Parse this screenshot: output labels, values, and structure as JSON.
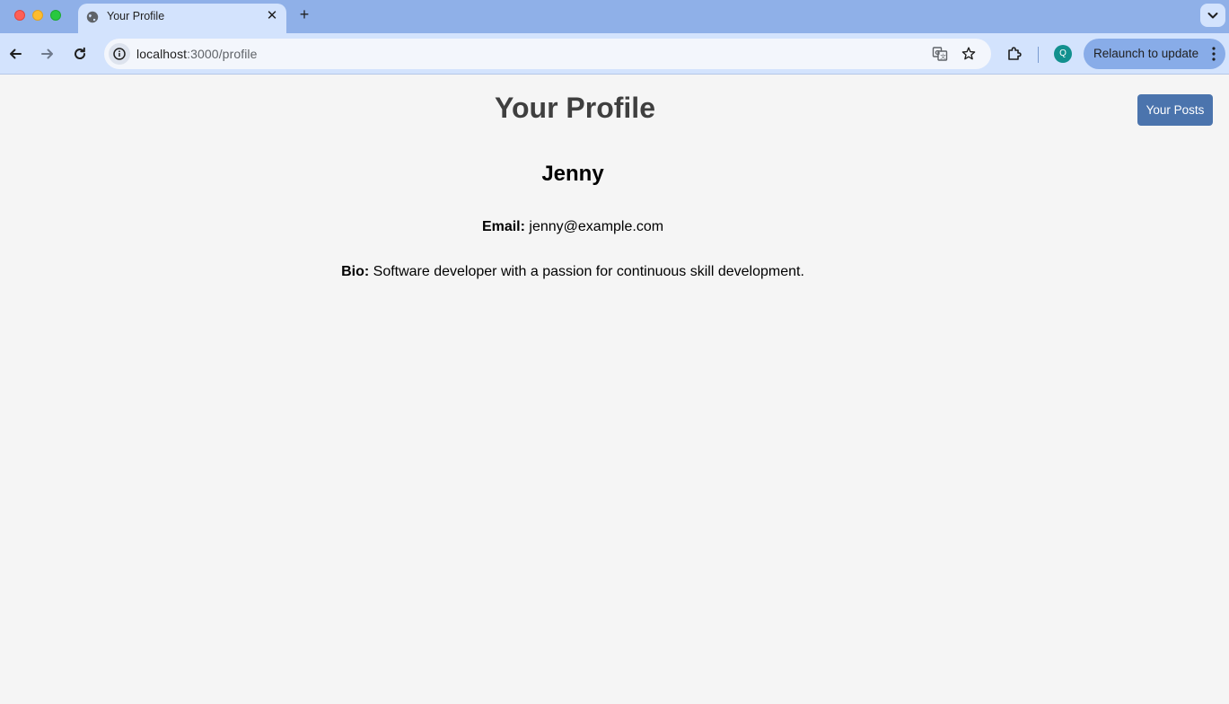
{
  "browser": {
    "tab": {
      "title": "Your Profile"
    },
    "url": {
      "host": "localhost",
      "path": ":3000/profile"
    },
    "relaunch_label": "Relaunch to update",
    "avatar_initial": "Q",
    "tab_close_glyph": "✕",
    "new_tab_glyph": "+",
    "icons": [
      "globe-icon",
      "close-icon",
      "plus-icon",
      "chevron-down-icon",
      "back-arrow-icon",
      "forward-arrow-icon",
      "reload-icon",
      "site-info-icon",
      "translate-icon",
      "star-icon",
      "extensions-icon",
      "more-vert-icon"
    ]
  },
  "page": {
    "title": "Your Profile",
    "posts_button": "Your Posts",
    "user": {
      "name": "Jenny",
      "email_label": "Email:",
      "email": "jenny@example.com",
      "bio_label": "Bio:",
      "bio": "Software developer with a passion for continuous skill development."
    }
  },
  "colors": {
    "tabbar": "#8fb0e8",
    "toolbar": "#d3e3fd",
    "page_bg": "#f5f5f5",
    "button": "#4b74ad",
    "avatar": "#12908e"
  }
}
